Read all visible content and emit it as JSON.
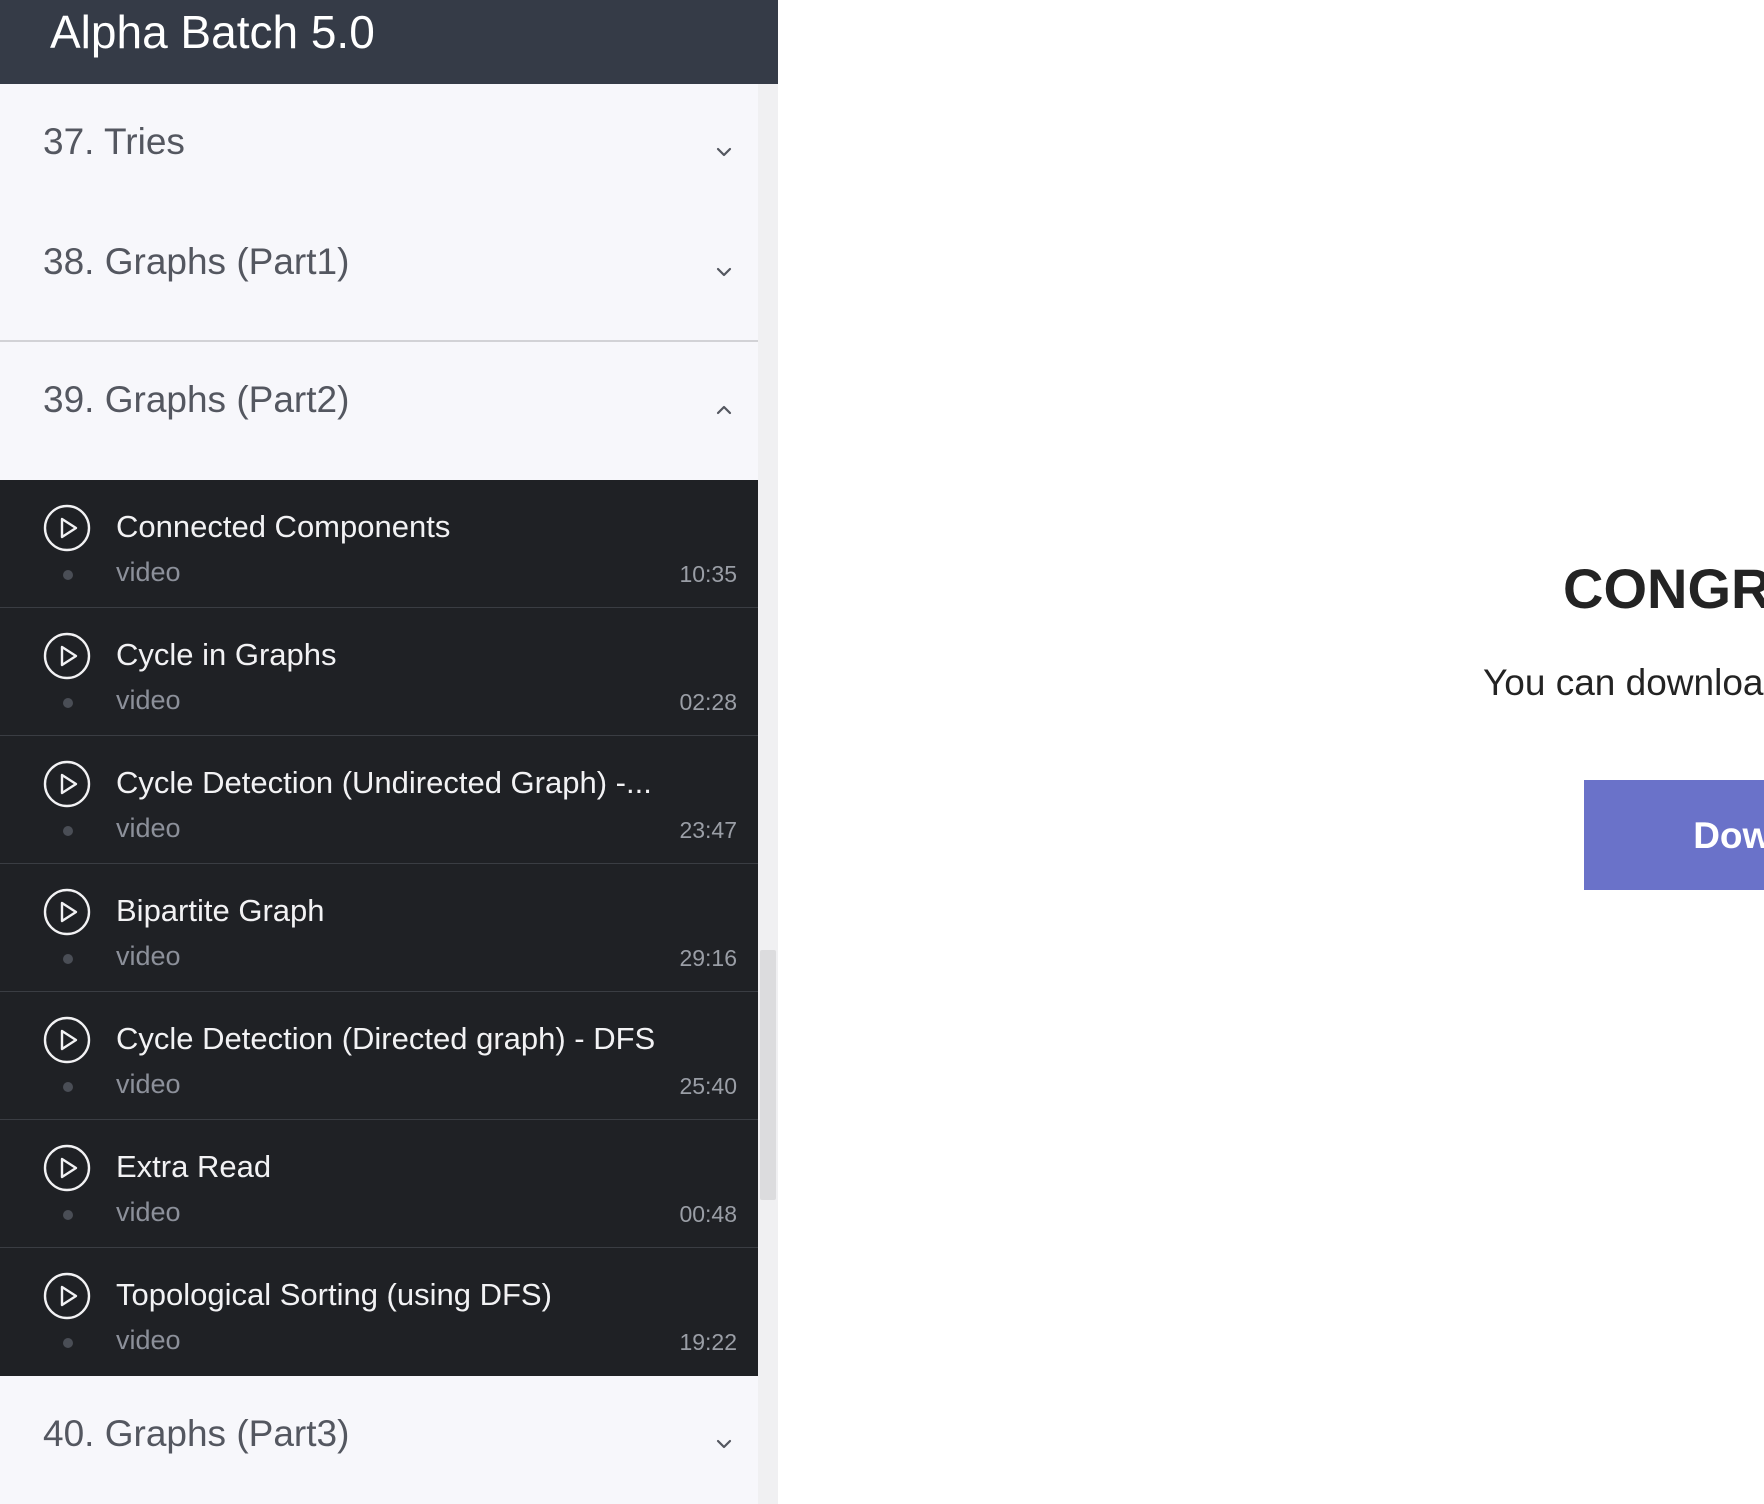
{
  "sidebar": {
    "title": "Alpha Batch 5.0",
    "sections": [
      {
        "label": "37. Tries",
        "expanded": false
      },
      {
        "label": "38. Graphs (Part1)",
        "expanded": false
      },
      {
        "label": "39. Graphs (Part2)",
        "expanded": true
      },
      {
        "label": "40. Graphs (Part3)",
        "expanded": false
      }
    ],
    "lessons": [
      {
        "title": "Connected Components",
        "type": "video",
        "duration": "10:35"
      },
      {
        "title": "Cycle in Graphs",
        "type": "video",
        "duration": "02:28"
      },
      {
        "title": "Cycle Detection (Undirected Graph) -...",
        "type": "video",
        "duration": "23:47"
      },
      {
        "title": "Bipartite Graph",
        "type": "video",
        "duration": "29:16"
      },
      {
        "title": "Cycle Detection (Directed graph) - DFS",
        "type": "video",
        "duration": "25:40"
      },
      {
        "title": "Extra Read",
        "type": "video",
        "duration": "00:48"
      },
      {
        "title": "Topological Sorting (using DFS)",
        "type": "video",
        "duration": "19:22"
      }
    ]
  },
  "main": {
    "heading": "CONGRA",
    "message": "You can downloa",
    "button_label": "Downlo"
  },
  "colors": {
    "header_bg": "#353b47",
    "lesson_bg": "#1f2125",
    "button_bg": "#6a72c9"
  }
}
